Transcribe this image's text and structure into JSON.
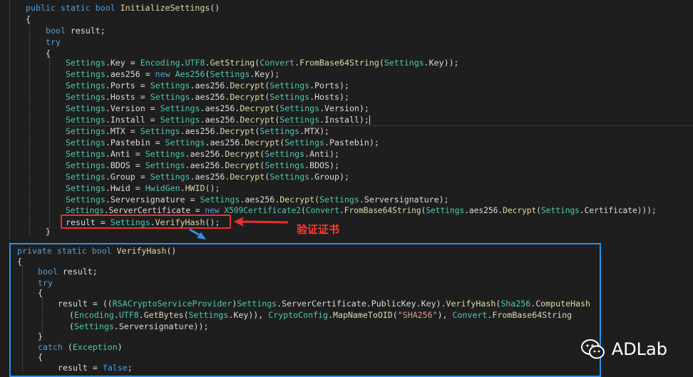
{
  "annotation_label": "验证证书",
  "watermark": "ADLab",
  "code_top": [
    "public static bool InitializeSettings()",
    "{",
    "bool result;",
    "try",
    "{",
    "Settings.Key = Encoding.UTF8.GetString(Convert.FromBase64String(Settings.Key));",
    "Settings.aes256 = new Aes256(Settings.Key);",
    "Settings.Ports = Settings.aes256.Decrypt(Settings.Ports);",
    "Settings.Hosts = Settings.aes256.Decrypt(Settings.Hosts);",
    "Settings.Version = Settings.aes256.Decrypt(Settings.Version);",
    "Settings.Install = Settings.aes256.Decrypt(Settings.Install);",
    "Settings.MTX = Settings.aes256.Decrypt(Settings.MTX);",
    "Settings.Pastebin = Settings.aes256.Decrypt(Settings.Pastebin);",
    "Settings.Anti = Settings.aes256.Decrypt(Settings.Anti);",
    "Settings.BDOS = Settings.aes256.Decrypt(Settings.BDOS);",
    "Settings.Group = Settings.aes256.Decrypt(Settings.Group);",
    "Settings.Hwid = HwidGen.HWID();",
    "Settings.Serversignature = Settings.aes256.Decrypt(Settings.Serversignature);",
    "Settings.ServerCertificate = new X509Certificate2(Convert.FromBase64String(Settings.aes256.Decrypt(Settings.Certificate)));",
    "result = Settings.VerifyHash();",
    "}"
  ],
  "code_bottom": [
    "private static bool VerifyHash()",
    "{",
    "bool result;",
    "try",
    "{",
    "result = ((RSACryptoServiceProvider)Settings.ServerCertificate.PublicKey.Key).VerifyHash(Sha256.ComputeHash",
    "(Encoding.UTF8.GetBytes(Settings.Key)), CryptoConfig.MapNameToOID(\"SHA256\"), Convert.FromBase64String",
    "(Settings.Serversignature));",
    "}",
    "catch (Exception)",
    "{",
    "result = false;"
  ]
}
